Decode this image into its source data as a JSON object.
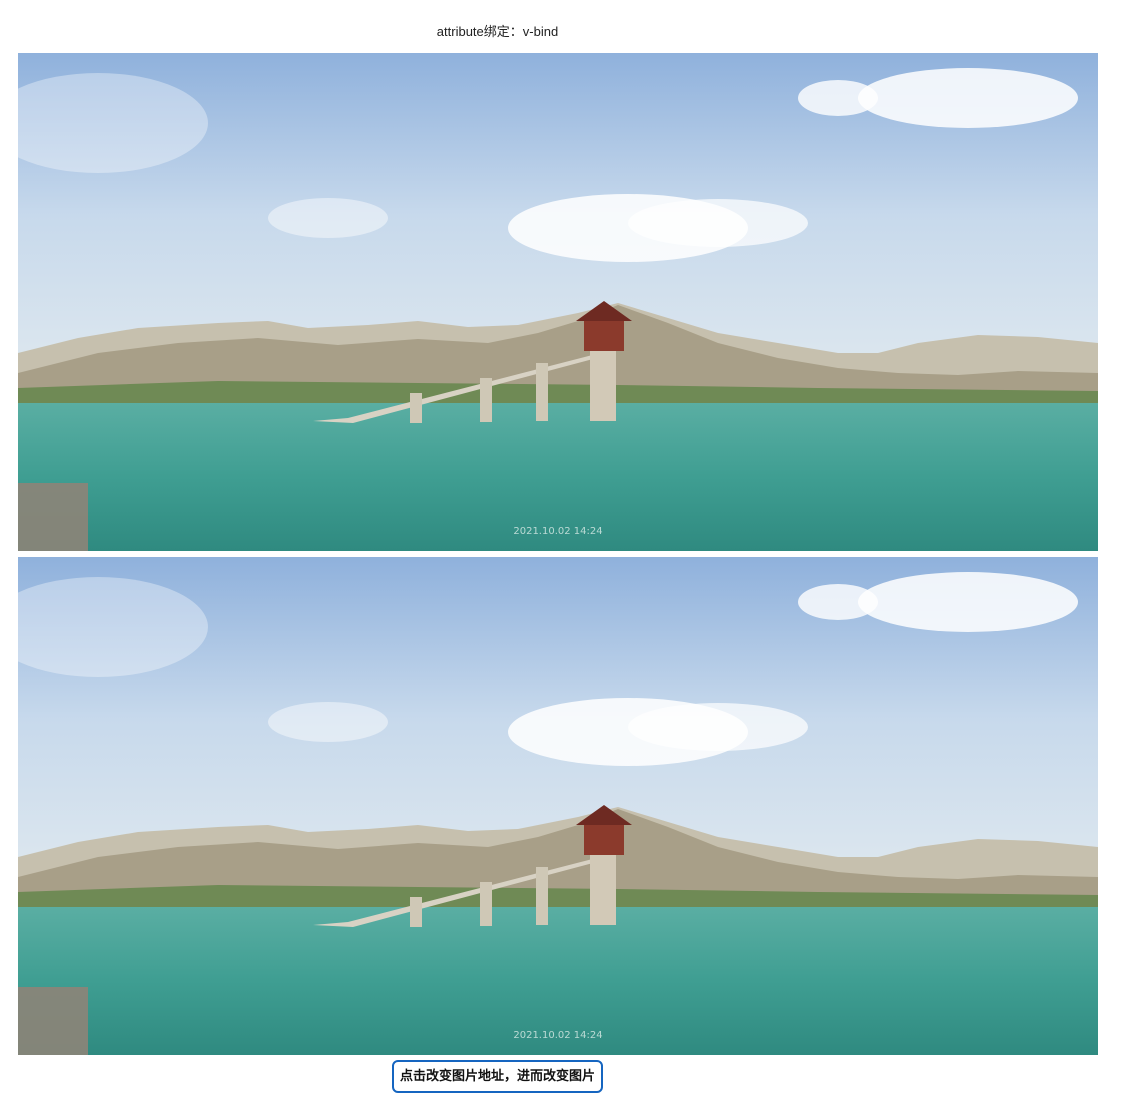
{
  "page": {
    "heading": "attribute绑定：v-bind"
  },
  "images": [
    {
      "alt": "湖面取水塔风景照",
      "timestamp": "2021.10.02 14:24"
    },
    {
      "alt": "湖面取水塔风景照",
      "timestamp": "2021.10.02 14:24"
    }
  ],
  "button": {
    "label": "点击改变图片地址，进而改变图片"
  },
  "colors": {
    "sky_top": "#8fb1dc",
    "sky_bottom": "#dfe9f0",
    "water": "#3f9e92",
    "tower": "#c9bfae",
    "roof": "#7a2c22",
    "button_border": "#1565c0"
  }
}
